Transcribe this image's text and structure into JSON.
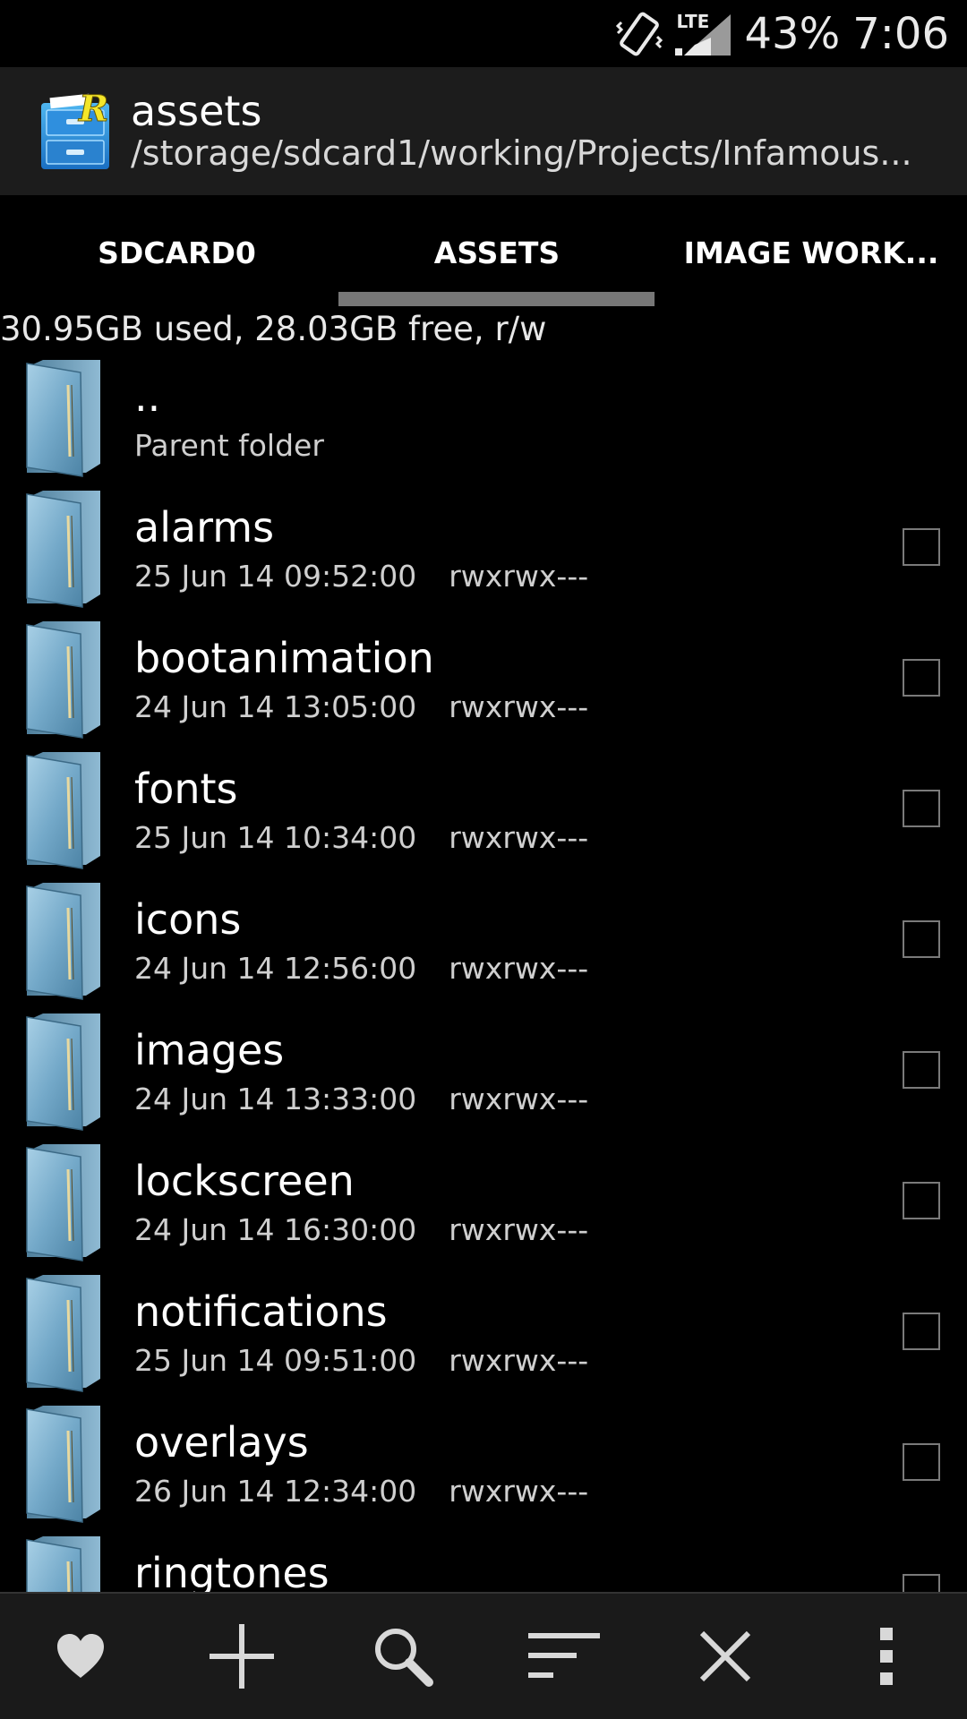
{
  "status_bar": {
    "battery": "43%",
    "time": "7:06",
    "network": "LTE",
    "icons": [
      "vibrate-icon",
      "lte-signal-icon"
    ]
  },
  "action_bar": {
    "title": "assets",
    "path": "/storage/sdcard1/working/Projects/Infamous..."
  },
  "tabs": [
    {
      "label": "SDCARD0",
      "active": false
    },
    {
      "label": "ASSETS",
      "active": true
    },
    {
      "label": "IMAGE WORK...",
      "active": false
    }
  ],
  "storage_info": "30.95GB used, 28.03GB free, r/w",
  "parent_folder": {
    "name": "..",
    "label": "Parent folder"
  },
  "items": [
    {
      "name": "alarms",
      "date": "25 Jun 14 09:52:00",
      "perm": "rwxrwx---"
    },
    {
      "name": "bootanimation",
      "date": "24 Jun 14 13:05:00",
      "perm": "rwxrwx---"
    },
    {
      "name": "fonts",
      "date": "25 Jun 14 10:34:00",
      "perm": "rwxrwx---"
    },
    {
      "name": "icons",
      "date": "24 Jun 14 12:56:00",
      "perm": "rwxrwx---"
    },
    {
      "name": "images",
      "date": "24 Jun 14 13:33:00",
      "perm": "rwxrwx---"
    },
    {
      "name": "lockscreen",
      "date": "24 Jun 14 16:30:00",
      "perm": "rwxrwx---"
    },
    {
      "name": "notifications",
      "date": "25 Jun 14 09:51:00",
      "perm": "rwxrwx---"
    },
    {
      "name": "overlays",
      "date": "26 Jun 14 12:34:00",
      "perm": "rwxrwx---"
    },
    {
      "name": "ringtones",
      "date": "",
      "perm": ""
    }
  ],
  "toolbar": {
    "icons": [
      "favorites-icon",
      "add-icon",
      "search-icon",
      "sort-icon",
      "close-icon",
      "overflow-menu-icon"
    ]
  },
  "colors": {
    "background": "#000000",
    "action_bar": "#1c1c1c",
    "tab_indicator": "#777777",
    "folder": "#6fa3c4",
    "toolbar": "#1a1a1a"
  }
}
